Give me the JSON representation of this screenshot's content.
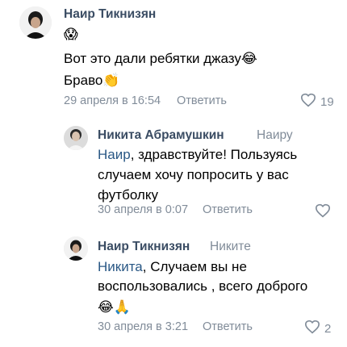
{
  "comments": [
    {
      "author": "Наир Тикнизян",
      "emoji_line": "😱",
      "line1": "Вот это дали ребятки джазу😂",
      "line2": "Браво👏",
      "date": "29 апреля в 16:54",
      "reply_label": "Ответить",
      "likes": "19"
    },
    {
      "author": "Никита Абрамушкин",
      "reply_to": "Наиру",
      "mention": "Наир",
      "line1_rest": ", здравствуйте! Пользуясь",
      "line2": "случаем хочу попросить у вас",
      "line3": "футболку",
      "date": "30 апреля в 0:07",
      "reply_label": "Ответить",
      "likes": ""
    },
    {
      "author": "Наир Тикнизян",
      "reply_to": "Никите",
      "mention": "Никита",
      "line1_rest": ", Случаем вы не",
      "line2": "воспользовались , всего доброго",
      "line3": "😂🙏",
      "date": "30 апреля в 3:21",
      "reply_label": "Ответить",
      "likes": "2"
    }
  ]
}
